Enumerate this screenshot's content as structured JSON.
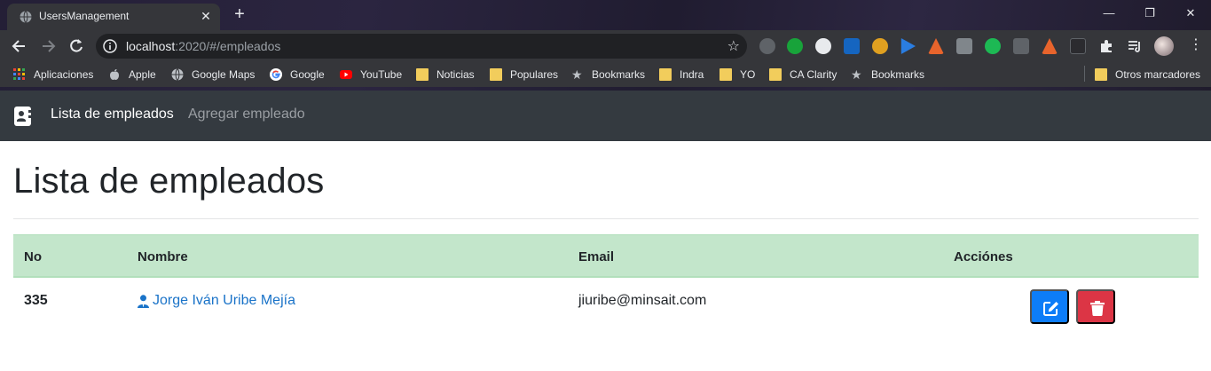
{
  "browser": {
    "tab_title": "UsersManagement",
    "url_host": "localhost",
    "url_rest": ":2020/#/empleados",
    "bookmarks": [
      {
        "label": "Aplicaciones",
        "icon": "apps-grid-icon"
      },
      {
        "label": "Apple",
        "icon": "apple-icon"
      },
      {
        "label": "Google Maps",
        "icon": "globe-icon"
      },
      {
        "label": "Google",
        "icon": "google-icon"
      },
      {
        "label": "YouTube",
        "icon": "youtube-icon"
      },
      {
        "label": "Noticias",
        "icon": "folder-icon"
      },
      {
        "label": "Populares",
        "icon": "folder-icon"
      },
      {
        "label": "Bookmarks",
        "icon": "star-icon"
      },
      {
        "label": "Indra",
        "icon": "folder-icon"
      },
      {
        "label": "YO",
        "icon": "folder-icon"
      },
      {
        "label": "CA Clarity",
        "icon": "folder-icon"
      },
      {
        "label": "Bookmarks",
        "icon": "star-icon"
      }
    ],
    "other_bookmarks": "Otros marcadores"
  },
  "navbar": {
    "brand_icon": "address-card-icon",
    "links": [
      {
        "label": "Lista de empleados",
        "active": true
      },
      {
        "label": "Agregar empleado",
        "active": false
      }
    ]
  },
  "page": {
    "title": "Lista de empleados"
  },
  "table": {
    "headers": [
      "No",
      "Nombre",
      "Email",
      "Acciónes"
    ],
    "rows": [
      {
        "no": "335",
        "nombre": "Jorge Iván Uribe Mejía",
        "email": "jiuribe@minsait.com"
      }
    ]
  },
  "colors": {
    "navbar": "#343a40",
    "table_head": "#c3e6cb",
    "edit_button": "#0d7df8",
    "delete_button": "#dc3545",
    "link": "#1a73c8"
  }
}
